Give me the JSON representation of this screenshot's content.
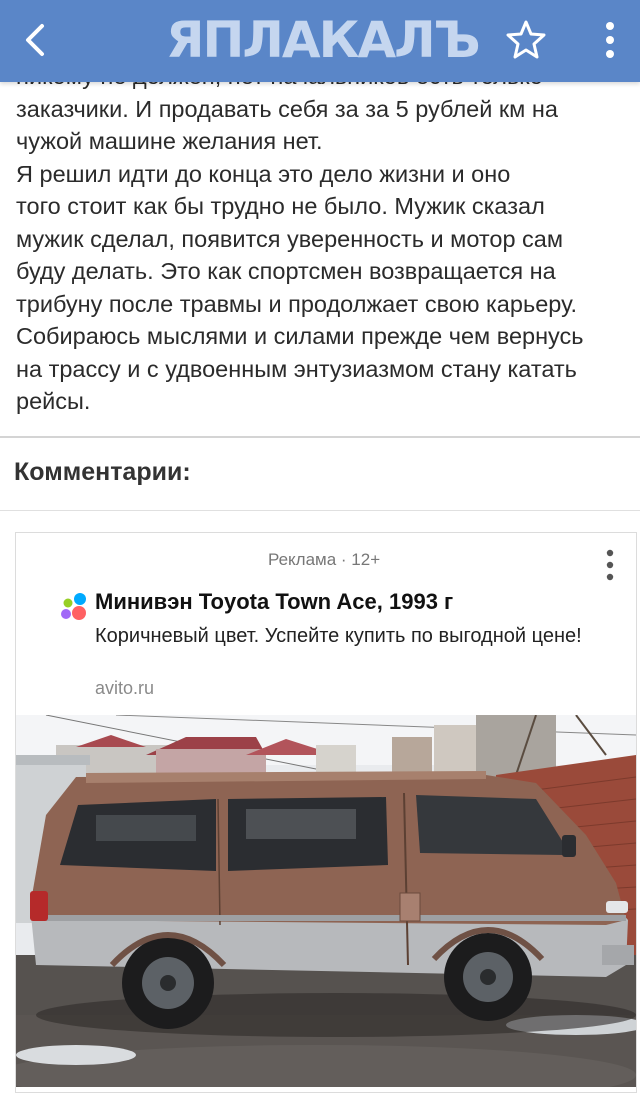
{
  "header": {
    "logo_text": "ЯПЛАКАЛЪ",
    "icons": {
      "back": "back-arrow-icon",
      "star": "star-icon",
      "menu": "more-vert-icon"
    },
    "colors": {
      "background": "#5a86c8",
      "logo": "#c5d6ef"
    }
  },
  "article": {
    "lines": [
      "никому не должен, нет начальников есть только",
      "заказчики. И продавать себя за за 5 рублей км на",
      "чужой машине желания нет.",
      "Я решил идти до конца это дело жизни и оно",
      "того стоит как бы трудно не было. Мужик сказал",
      "мужик сделал, появится уверенность и мотор сам",
      "буду делать. Это как спортсмен возвращается на",
      "трибуну после травмы и продолжает свою карьеру.",
      "Собираюсь мыслями и силами прежде чем вернусь",
      "на трассу и с удвоенным энтузиазмом стану катать",
      "рейсы."
    ]
  },
  "comments": {
    "title": "Комментарии:"
  },
  "ad": {
    "label": "Реклама · 12+",
    "title": "Минивэн Toyota Town Ace, 1993 г",
    "description": "Коричневый цвет. Успейте купить по выгодной цене!",
    "domain": "avito.ru",
    "icons": {
      "menu": "more-vert-icon",
      "logo": "avito-logo-icon"
    },
    "image": "brown-minivan-photo"
  }
}
